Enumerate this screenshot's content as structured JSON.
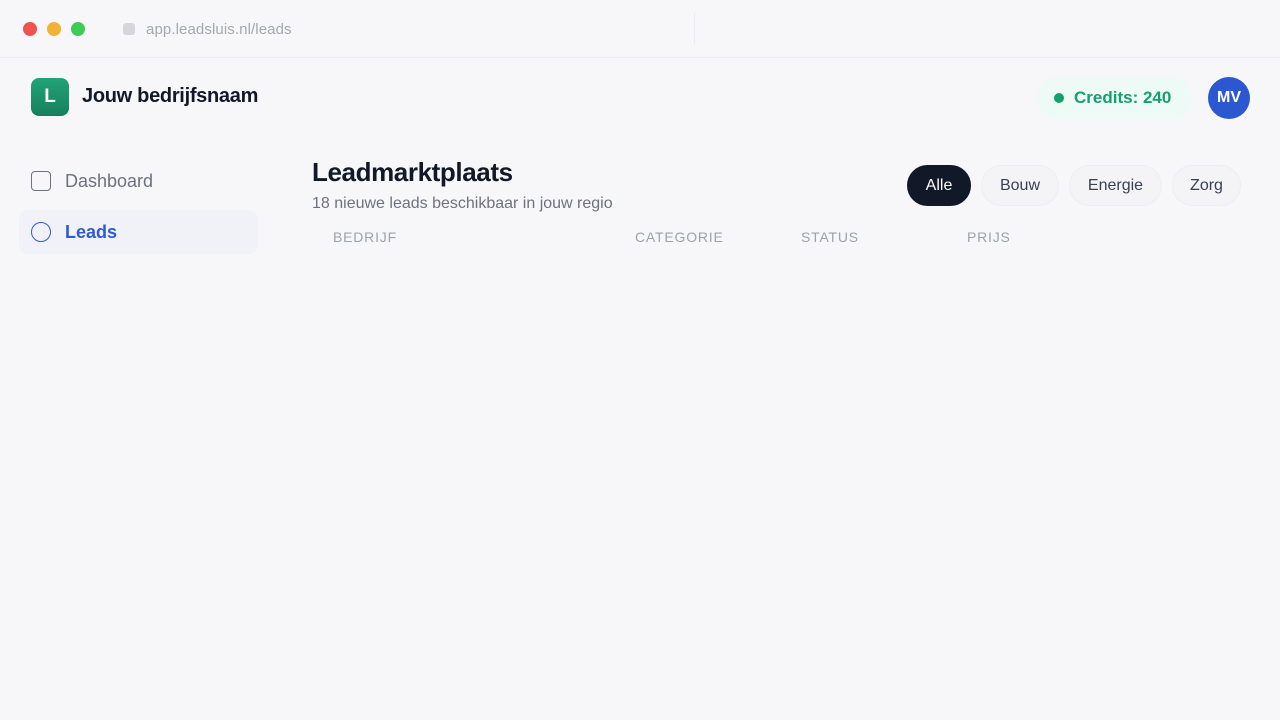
{
  "browser": {
    "url": "app.leadsluis.nl/leads"
  },
  "header": {
    "logo_letter": "L",
    "company_name": "Jouw bedrijfsnaam",
    "credits_label": "Credits: 240",
    "avatar_initials": "MV"
  },
  "sidebar": {
    "items": [
      {
        "label": "Dashboard",
        "icon": "square-icon",
        "active": false
      },
      {
        "label": "Leads",
        "icon": "circle-icon",
        "active": true
      }
    ]
  },
  "main": {
    "title": "Leadmarktplaats",
    "subtitle": "18 nieuwe leads beschikbaar in jouw regio",
    "filters": [
      {
        "label": "Alle",
        "active": true
      },
      {
        "label": "Bouw",
        "active": false
      },
      {
        "label": "Energie",
        "active": false
      },
      {
        "label": "Zorg",
        "active": false
      }
    ],
    "table": {
      "columns": [
        "BEDRIJF",
        "CATEGORIE",
        "STATUS",
        "PRIJS"
      ]
    }
  },
  "colors": {
    "brand_green": "#15805d",
    "accent_blue": "#2f5bd2",
    "credits_green": "#14a072",
    "dark": "#111827"
  }
}
